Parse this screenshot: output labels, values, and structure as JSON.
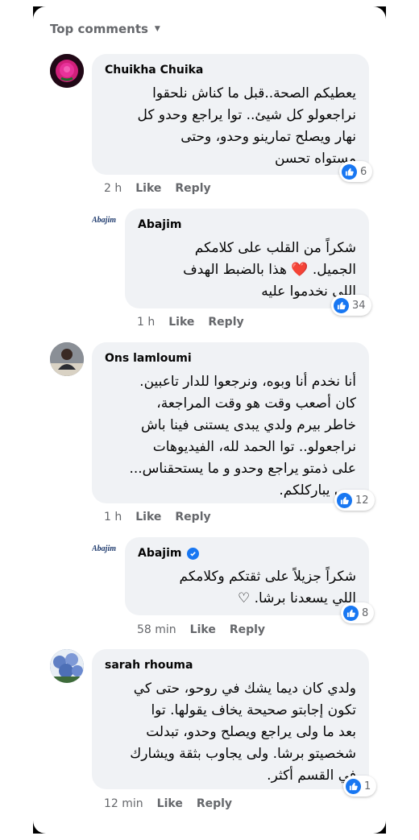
{
  "header": {
    "sort_label": "Top comments"
  },
  "comments": [
    {
      "author": "Chuikha Chuika",
      "text": "يعطيكم الصحة..قبل ما كناش نلحقوا\nنراجعولو كل شيئ.. توا يراجع وحدو كل\nنهار ويصلح تمارينو وحدو، وحتى\nمستواه تحسن",
      "reactions": "6",
      "time": "2 h",
      "like": "Like",
      "reply": "Reply"
    },
    {
      "author": "Abajim",
      "logo_text": "Abajim",
      "text": "شكراً من القلب على كلامكم\nالجميل. ❤️ هذا بالضبط الهدف\nاللي نخدموا عليه",
      "reactions": "34",
      "time": "1 h",
      "like": "Like",
      "reply": "Reply"
    },
    {
      "author": "Ons lamloumi",
      "text": "أنا نخدم أنا وبوه، ونرجعوا للدار تاعبين.\nكان أصعب وقت هو وقت المراجعة،\nخاطر بيرم ولدي يبدى يستنى فينا باش\nنراجعولو.. توا الحمد لله، الفيديوهات\nعلى ذمتو يراجع وحدو و ما يستحقناس...\nربي يباركلكم.",
      "reactions": "12",
      "time": "1 h",
      "like": "Like",
      "reply": "Reply"
    },
    {
      "author": "Abajim",
      "logo_text": "Abajim",
      "text": "شكراً جزيلاً على ثقتكم وكلامكم\nاللي يسعدنا برشا. ♡",
      "reactions": "8",
      "time": "58 min",
      "like": "Like",
      "reply": "Reply"
    },
    {
      "author": "sarah rhouma",
      "text": "ولدي كان ديما يشك في روحو، حتى كي\nتكون إجابتو صحيحة يخاف يقولها. توا\nبعد ما ولى يراجع ويصلح وحدو، تبدلت\nشخصيتو برشا. ولى يجاوب بثقة ويشارك\nفي القسم أكثر.",
      "reactions": "1",
      "time": "12 min",
      "like": "Like",
      "reply": "Reply"
    }
  ],
  "colors": {
    "accent": "#1877f2",
    "bubble": "#f0f2f5",
    "meta": "#65676b"
  },
  "icons": [
    "caret-down-icon",
    "like-icon",
    "verified-icon",
    "heart-icon"
  ]
}
